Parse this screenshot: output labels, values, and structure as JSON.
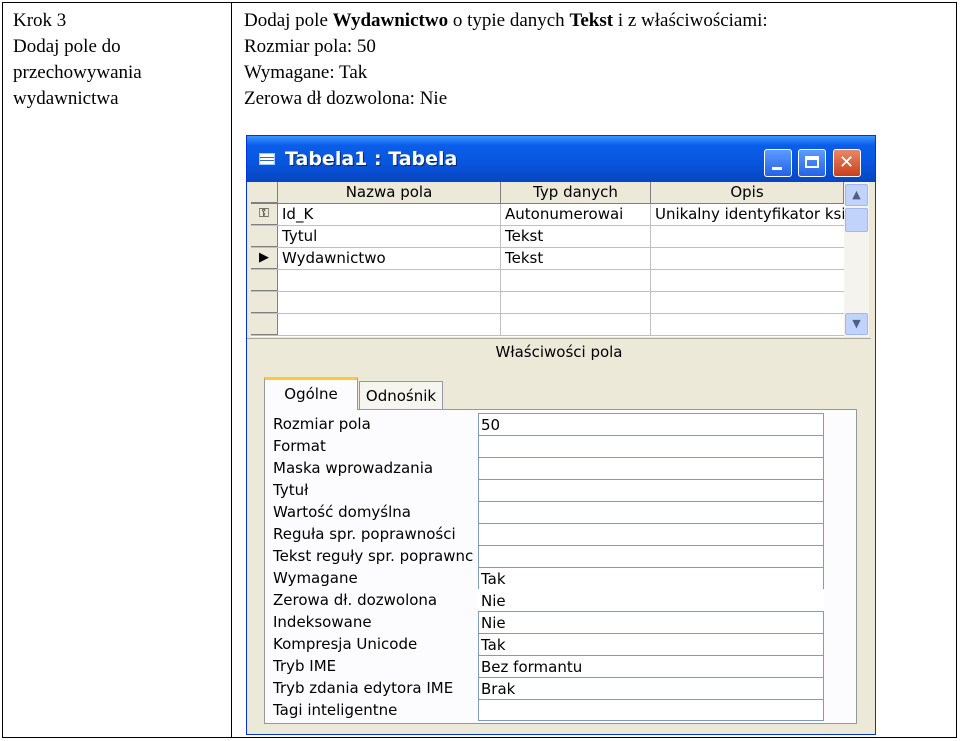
{
  "doc": {
    "left_lines": [
      "Krok 3",
      "Dodaj pole do",
      "przechowywania",
      "wydawnictwa"
    ],
    "right": {
      "line1_a": "Dodaj pole ",
      "line1_b": "Wydawnictwo",
      "line1_c": " o typie danych ",
      "line1_d": "Tekst",
      "line1_e": " i z właściwościami:",
      "line2": "Rozmiar pola: 50",
      "line3": "Wymagane: Tak",
      "line4": "Zerowa dł dozwolona: Nie"
    }
  },
  "window": {
    "title": "Tabela1 : Tabela",
    "grid": {
      "headers": [
        "Nazwa pola",
        "Typ danych",
        "Opis"
      ],
      "rows": [
        {
          "selector": "key",
          "name": "Id_K",
          "type": "Autonumerowai",
          "desc": "Unikalny identyfikator ksi"
        },
        {
          "selector": "",
          "name": "Tytul",
          "type": "Tekst",
          "desc": ""
        },
        {
          "selector": "current",
          "name": "Wydawnictwo",
          "type": "Tekst",
          "desc": ""
        },
        {
          "selector": "",
          "name": "",
          "type": "",
          "desc": ""
        },
        {
          "selector": "",
          "name": "",
          "type": "",
          "desc": ""
        },
        {
          "selector": "",
          "name": "",
          "type": "",
          "desc": ""
        }
      ]
    },
    "properties_title": "Właściwości pola",
    "tabs": [
      "Ogólne",
      "Odnośnik"
    ],
    "properties": [
      {
        "label": "Rozmiar pola",
        "value": "50"
      },
      {
        "label": "Format",
        "value": ""
      },
      {
        "label": "Maska wprowadzania",
        "value": ""
      },
      {
        "label": "Tytuł",
        "value": ""
      },
      {
        "label": "Wartość domyślna",
        "value": ""
      },
      {
        "label": "Reguła spr. poprawności",
        "value": ""
      },
      {
        "label": "Tekst reguły spr. poprawnc",
        "value": ""
      },
      {
        "label": "Wymagane",
        "value": "Tak"
      },
      {
        "label": "Zerowa dł. dozwolona",
        "value": "Nie"
      },
      {
        "label": "Indeksowane",
        "value": "Nie"
      },
      {
        "label": "Kompresja Unicode",
        "value": "Tak"
      },
      {
        "label": "Tryb IME",
        "value": "Bez formantu"
      },
      {
        "label": "Tryb zdania edytora IME",
        "value": "Brak"
      },
      {
        "label": "Tagi inteligentne",
        "value": ""
      }
    ]
  }
}
